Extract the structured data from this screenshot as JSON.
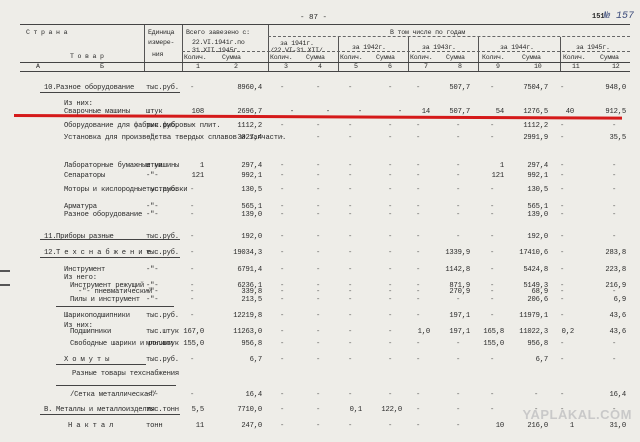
{
  "page_number": "- 87 -",
  "corner_number": "151",
  "stamp": "№ 157",
  "header": {
    "col_country": "С т р а н а",
    "col_goods": "Т о в а р",
    "col_unit": [
      "Единица",
      "измере-",
      "ния"
    ],
    "col_total": [
      "Всего завезено с:",
      "22.VI.1941г.по",
      "31.XII.1945г."
    ],
    "by_years": "В том числе по годам",
    "year_labels": [
      "за 1941г.",
      "за 1942г.",
      "за 1943г.",
      "за 1944г.",
      "за 1945г."
    ],
    "year_sublabels": [
      "/22.VI-31.XII/"
    ],
    "qty": "Колич.",
    "sum": "Сумма",
    "col_numbers": [
      "А",
      "Б",
      "1",
      "2",
      "3",
      "4",
      "5",
      "6",
      "7",
      "8",
      "9",
      "10",
      "11",
      "12"
    ]
  },
  "rows": [
    {
      "num": "10.",
      "name": "Разное оборудование",
      "unit": "тыс.руб.",
      "total_sum": "8960,4",
      "s43": "507,7",
      "s44": "7504,7",
      "s45": "948,0"
    },
    {
      "name": "Из них:"
    },
    {
      "name": "Сварочные машины",
      "unit": "штук",
      "total_qty": "108",
      "total_sum": "2696,7",
      "q1941": "-",
      "s1941": "-",
      "q1942": "-",
      "s1942": "-",
      "q43": "14",
      "s43": "507,7",
      "q44": "54",
      "s44": "1276,5",
      "q45": "40",
      "s45": "912,5"
    },
    {
      "name": "Оборудование для фабрик фибровых плит.",
      "unit": "тыс.руб.",
      "total_sum": "1112,2",
      "s44": "1112,2"
    },
    {
      "name": "Установка для производства твердых сплавов и запчасти.",
      "unit": "-\"-",
      "total_sum": "3027,4",
      "s44": "2991,9",
      "s45": "35,5"
    },
    {
      "name": "Лабораторные бумажные машины",
      "unit": "штук",
      "total_qty": "1",
      "total_sum": "297,4",
      "q44": "1",
      "s44": "297,4"
    },
    {
      "name": "Сепараторы",
      "unit": "-\"-",
      "total_qty": "121",
      "total_sum": "992,1",
      "q44": "121",
      "s44": "992,1"
    },
    {
      "name": "Моторы и кислородные установки",
      "unit": "тыс.руб.",
      "total_sum": "130,5",
      "s44": "130,5"
    },
    {
      "name": "Арматура",
      "unit": "-\"-",
      "total_sum": "565,1",
      "s44": "565,1"
    },
    {
      "name": "Разное оборудование",
      "unit": "-\"-",
      "total_sum": "139,0",
      "s44": "139,0"
    },
    {
      "num": "11.",
      "name": "Приборы разные",
      "unit": "тыс.руб.",
      "total_sum": "192,0",
      "s44": "192,0"
    },
    {
      "num": "12.",
      "name": "Т е х с н а б ж е н и е",
      "unit": "тыс.руб.",
      "total_sum": "19034,3",
      "s43": "1339,9",
      "s44": "17410,6",
      "s45": "283,8"
    },
    {
      "name": "Инструмент",
      "unit": "-\"-",
      "total_sum": "6791,4",
      "s43": "1142,8",
      "s44": "5424,8",
      "s45": "223,8"
    },
    {
      "name": "Из него:"
    },
    {
      "name": "Инструмент режущий",
      "unit": "-\"-",
      "total_sum": "6236,1",
      "s43": "871,9",
      "s44": "5149,3",
      "s45": "216,9"
    },
    {
      "name": "-\"- пневматический",
      "unit": "-\"-",
      "total_sum": "339,8",
      "s43": "270,9",
      "s44": "68,9"
    },
    {
      "name": "Пилы и инструмент",
      "unit": "-\"-",
      "total_sum": "213,5",
      "s44": "206,6",
      "s45": "6,9"
    },
    {
      "name": "Шарикоподшипники",
      "unit": "тыс.руб.",
      "total_sum": "12219,8",
      "s43": "197,1",
      "s44": "11979,1",
      "s45": "43,6"
    },
    {
      "name": "Из них:"
    },
    {
      "name": "Подшипники",
      "unit": "тыс.штук",
      "total_qty": "167,0",
      "total_sum": "11263,0",
      "q43": "1,0",
      "s43": "197,1",
      "q44": "165,8",
      "s44": "11022,3",
      "q45": "0,2",
      "s45": "43,6"
    },
    {
      "name": "Свободные шарики и ролики",
      "unit": "млн.штук",
      "total_qty": "155,0",
      "total_sum": "956,8",
      "q44": "155,0",
      "s44": "956,8"
    },
    {
      "name": "Х о м у т ы",
      "unit": "тыс.руб.",
      "total_sum": "6,7",
      "s44": "6,7"
    },
    {
      "name": "Разные товары техснабжения"
    },
    {
      "name": "/Сетка металлическая/",
      "unit": "-\"-",
      "total_sum": "16,4",
      "s45": "16,4"
    },
    {
      "num": "В.",
      "name": "Металлы и металлоизделия",
      "unit": "тыс.тонн",
      "total_qty": "5,5",
      "total_sum": "7710,0",
      "q1942": "0,1",
      "s1942": "122,0"
    },
    {
      "name": "Н а к т а л",
      "unit": "тонн",
      "total_qty": "11",
      "total_sum": "247,0",
      "q44": "10",
      "s44": "216,0",
      "q45": "1",
      "s45": "31,0"
    }
  ],
  "watermark": "YAPLAKAL.COM"
}
